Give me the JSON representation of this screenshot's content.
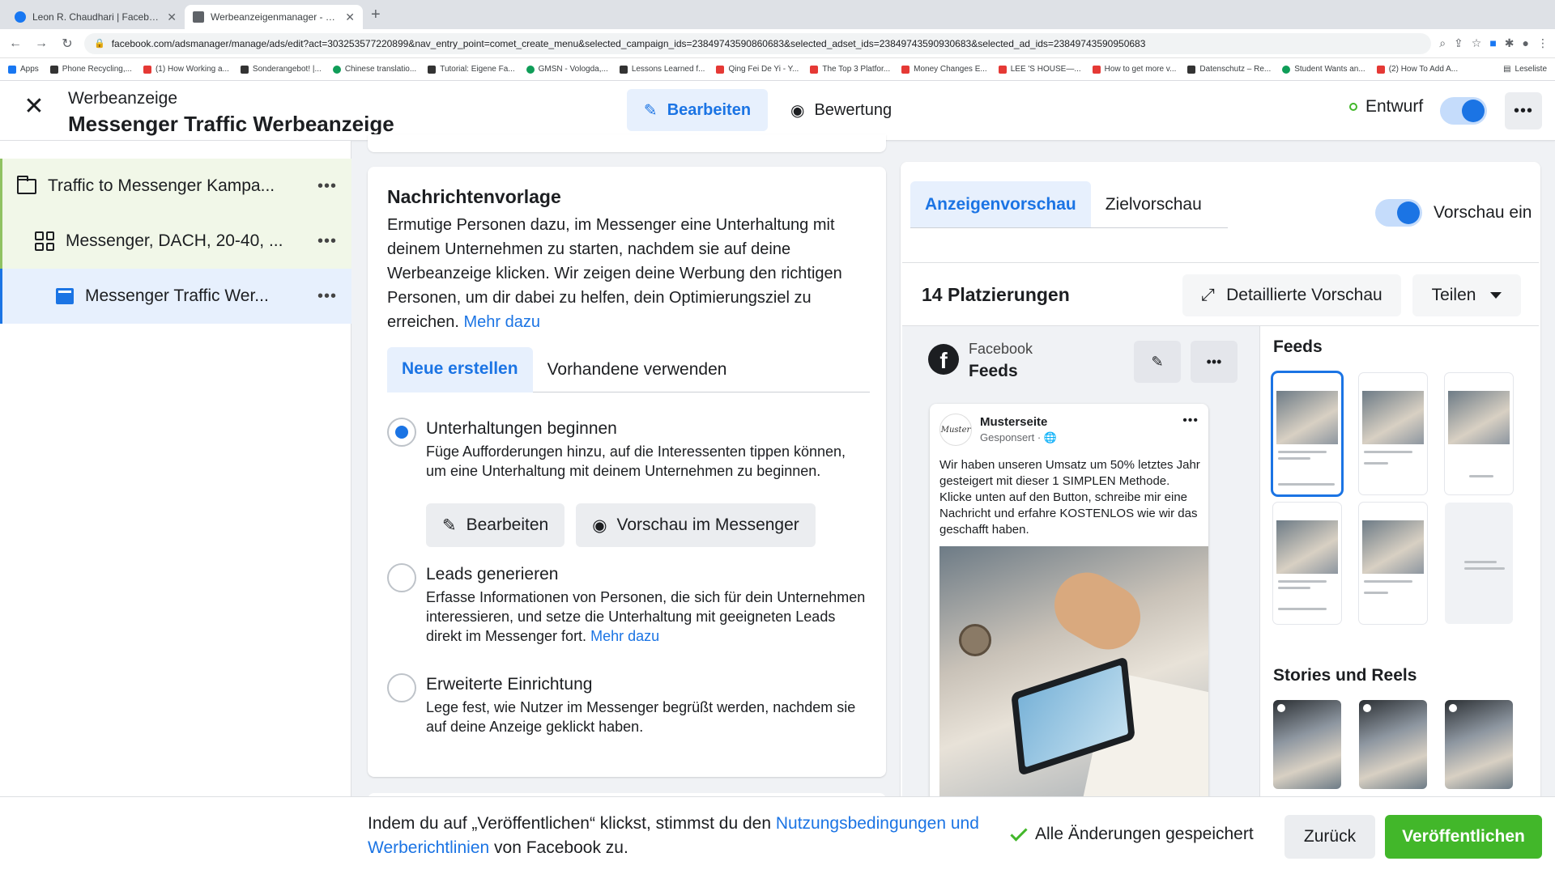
{
  "browser": {
    "tabs": [
      {
        "title": "Leon R. Chaudhari | Facebook",
        "active": false
      },
      {
        "title": "Werbeanzeigenmanager - Wer",
        "active": true
      }
    ],
    "url": "facebook.com/adsmanager/manage/ads/edit?act=303253577220899&nav_entry_point=comet_create_menu&selected_campaign_ids=23849743590860683&selected_adset_ids=23849743590930683&selected_ad_ids=23849743590950683",
    "bookmarks": [
      "Apps",
      "Phone Recycling,...",
      "(1) How Working a...",
      "Sonderangebot! |...",
      "Chinese translatio...",
      "Tutorial: Eigene Fa...",
      "GMSN - Vologda,...",
      "Lessons Learned f...",
      "Qing Fei De Yi - Y...",
      "The Top 3 Platfor...",
      "Money Changes E...",
      "LEE 'S HOUSE—...",
      "How to get more v...",
      "Datenschutz – Re...",
      "Student Wants an...",
      "(2) How To Add A..."
    ],
    "reading_list": "Leseliste"
  },
  "header": {
    "subtitle": "Werbeanzeige",
    "title": "Messenger Traffic Werbeanzeige",
    "edit_label": "Bearbeiten",
    "review_label": "Bewertung",
    "status_label": "Entwurf"
  },
  "sidebar": {
    "items": [
      {
        "label": "Traffic to Messenger Kampa..."
      },
      {
        "label": "Messenger, DACH, 20-40, ..."
      },
      {
        "label": "Messenger Traffic Wer..."
      }
    ]
  },
  "template_card": {
    "title": "Nachrichtenvorlage",
    "description": "Ermutige Personen dazu, im Messenger eine Unterhaltung mit deinem Unternehmen zu starten, nachdem sie auf deine Werbeanzeige klicken. Wir zeigen deine Werbung den richtigen Personen, um dir dabei zu helfen, dein Optimierungsziel zu erreichen.",
    "more_link": "Mehr dazu",
    "tabs": [
      "Neue erstellen",
      "Vorhandene verwenden"
    ],
    "options": [
      {
        "title": "Unterhaltungen beginnen",
        "desc": "Füge Aufforderungen hinzu, auf die Interessenten tippen können, um eine Unterhaltung mit deinem Unternehmen zu beginnen.",
        "selected": true
      },
      {
        "title": "Leads generieren",
        "desc": "Erfasse Informationen von Personen, die sich für dein Unternehmen interessieren, und setze die Unterhaltung mit geeigneten Leads direkt im Messenger fort.",
        "link": "Mehr dazu",
        "selected": false
      },
      {
        "title": "Erweiterte Einrichtung",
        "desc": "Lege fest, wie Nutzer im Messenger begrüßt werden, nachdem sie auf deine Anzeige geklickt haben.",
        "selected": false
      }
    ],
    "edit_button": "Bearbeiten",
    "preview_messenger_button": "Vorschau im Messenger"
  },
  "preview": {
    "tabs": [
      "Anzeigenvorschau",
      "Zielvorschau"
    ],
    "toggle_label": "Vorschau ein",
    "placements_title": "14 Platzierungen",
    "detail_button": "Detaillierte Vorschau",
    "share_button": "Teilen",
    "platform": "Facebook",
    "placement": "Feeds",
    "post": {
      "avatar_text": "Muster",
      "page_name": "Musterseite",
      "sponsored": "Gesponsert · 🌐",
      "text": "Wir haben unseren Umsatz um 50% letztes Jahr gesteigert mit dieser 1 SIMPLEN Methode. Klicke unten auf den Button, schreibe mir eine Nachricht und erfahre KOSTENLOS wie wir das geschafft haben."
    },
    "sections": [
      "Feeds",
      "Stories und Reels"
    ]
  },
  "footer": {
    "text_before": "Indem du auf „Veröffentlichen“ klickst, stimmst du den ",
    "terms_link": "Nutzungsbedingungen und Werberichtlinien",
    "text_after": " von Facebook zu.",
    "saved_label": "Alle Änderungen gespeichert",
    "back_button": "Zurück",
    "publish_button": "Veröffentlichen"
  },
  "colors": {
    "accent": "#1b74e4",
    "publish_green": "#42b72a",
    "highlight_bg": "#e7f0fd",
    "campaign_bg": "#f1f7e8"
  }
}
